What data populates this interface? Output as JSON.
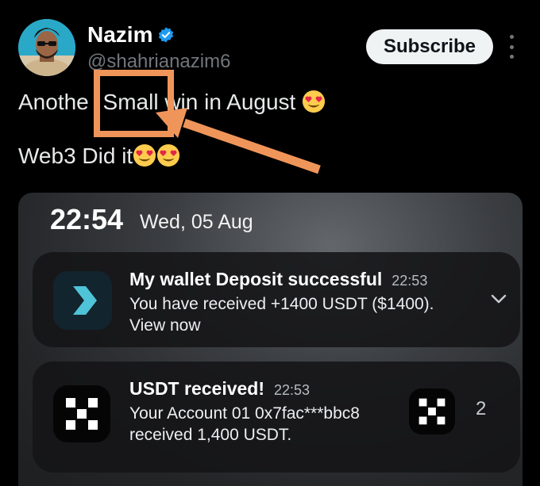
{
  "author": {
    "name": "Nazim",
    "handle": "@shahrianazim6",
    "verified_icon": "verified-badge-icon"
  },
  "actions": {
    "subscribe_label": "Subscribe",
    "more_icon": "more-vertical-icon"
  },
  "tweet": {
    "line1_prefix": "Anothe",
    "line1_highlight": "Small",
    "line1_suffix": "win in August",
    "line2_text": "Web3 Did it",
    "emoji": "heart-eyes-emoji"
  },
  "annotation": {
    "color": "#f0955a",
    "icon": "arrow-icon"
  },
  "screenshot": {
    "time": "22:54",
    "date": "Wed, 05 Aug",
    "notifications": [
      {
        "title": "My wallet Deposit successful",
        "time": "22:53",
        "body_line1": "You have received +1400 USDT ($1400).",
        "body_line2": "View now",
        "icon": "chevron-right-app-icon"
      },
      {
        "title": "USDT received!",
        "time": "22:53",
        "body_line1": "Your Account 01 0x7fac***bbc8",
        "body_line2": "received 1,400 USDT.",
        "icon": "okx-logo-icon",
        "count": "2"
      }
    ]
  },
  "colors": {
    "background": "#000000",
    "verified": "#1d9bf0",
    "subscribe_bg": "#eff3f4",
    "accent_teal": "#4fc3d8"
  }
}
